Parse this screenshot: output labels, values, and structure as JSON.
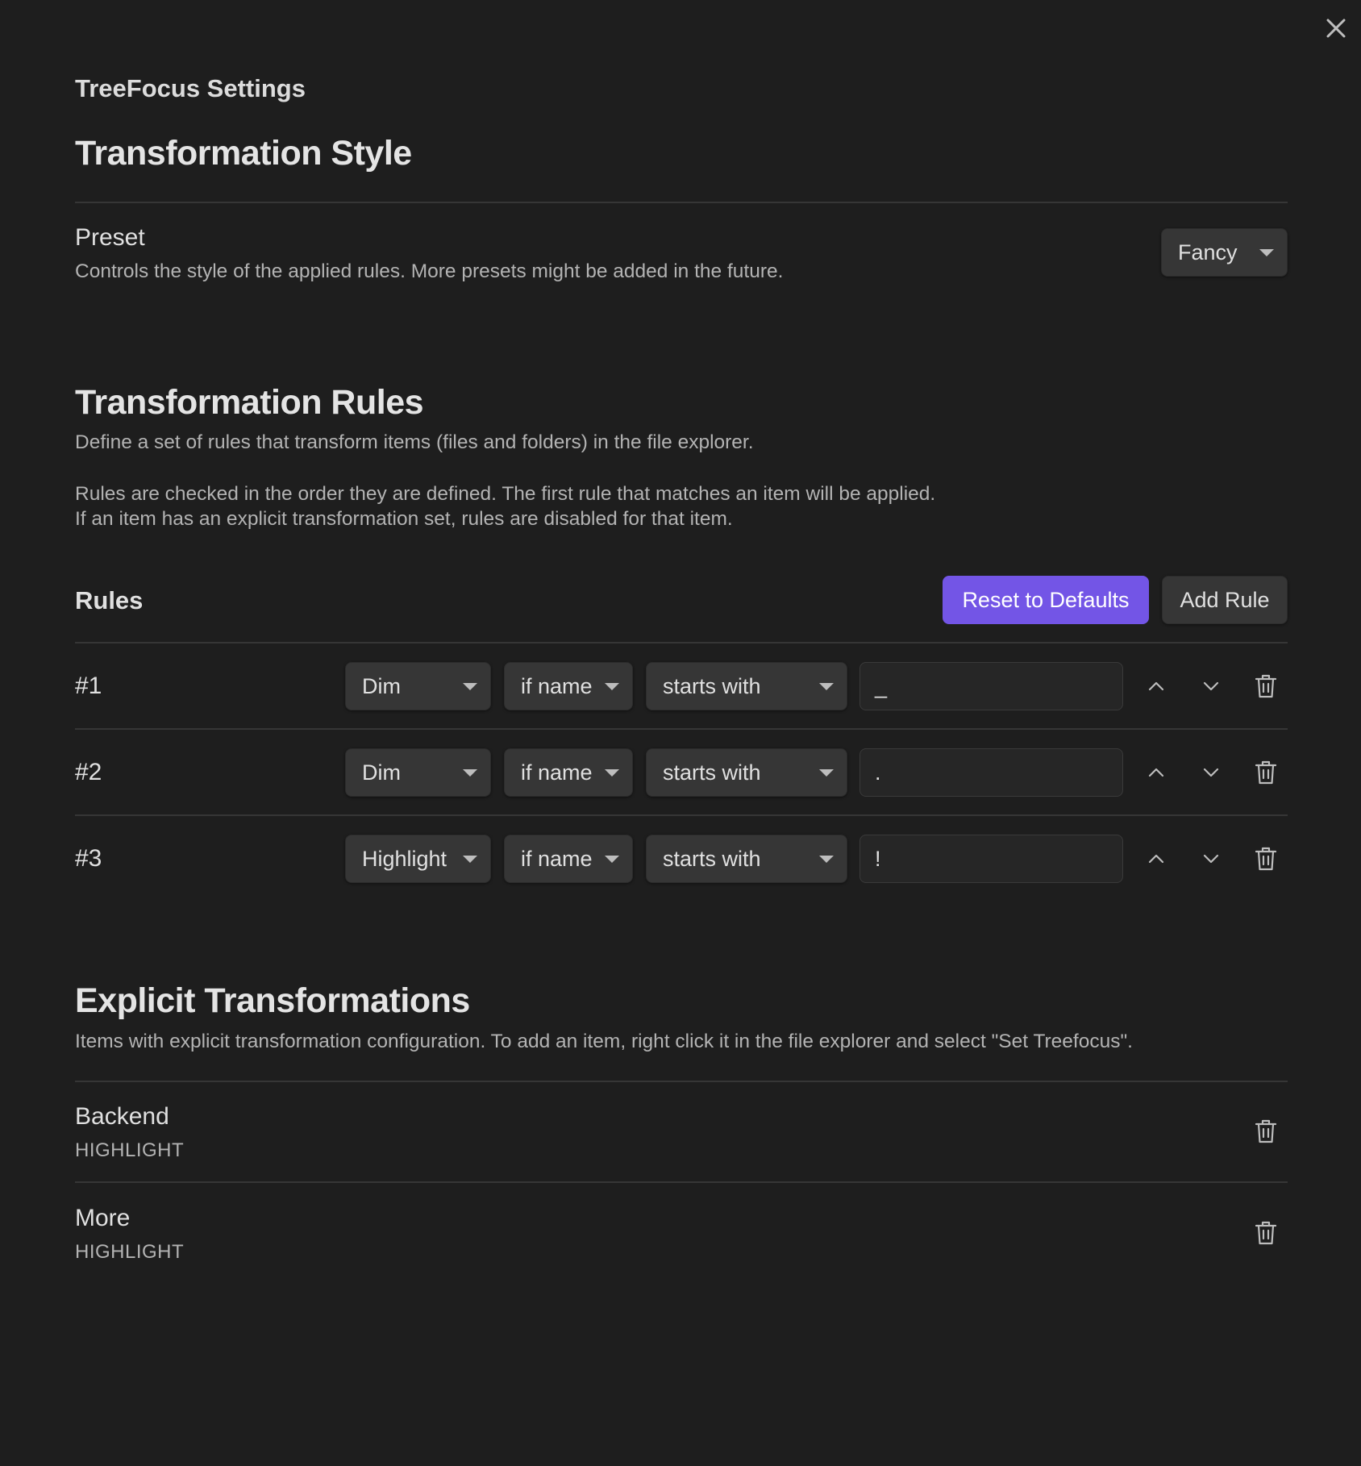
{
  "modal": {
    "plugin_title": "TreeFocus Settings",
    "close_icon": "close-icon"
  },
  "style_section": {
    "heading": "Transformation Style",
    "preset": {
      "name": "Preset",
      "description": "Controls the style of the applied rules. More presets might be added in the future.",
      "value": "Fancy"
    }
  },
  "rules_section": {
    "heading": "Transformation Rules",
    "description_1": "Define a set of rules that transform items (files and folders) in the file explorer.",
    "description_2": "Rules are checked in the order they are defined. The first rule that matches an item will be applied.\nIf an item has an explicit transformation set, rules are disabled for that item.",
    "rules_label": "Rules",
    "reset_label": "Reset to Defaults",
    "add_label": "Add Rule",
    "rules": [
      {
        "number": "#1",
        "action": "Dim",
        "field": "if name",
        "operator": "starts with",
        "value": "_"
      },
      {
        "number": "#2",
        "action": "Dim",
        "field": "if name",
        "operator": "starts with",
        "value": "."
      },
      {
        "number": "#3",
        "action": "Highlight",
        "field": "if name",
        "operator": "starts with",
        "value": "!"
      }
    ]
  },
  "explicit_section": {
    "heading": "Explicit Transformations",
    "description": "Items with explicit transformation configuration. To add an item, right click it in the file explorer and select \"Set Treefocus\".",
    "items": [
      {
        "name": "Backend",
        "type": "HIGHLIGHT"
      },
      {
        "name": "More",
        "type": "HIGHLIGHT"
      }
    ]
  },
  "colors": {
    "background": "#1e1e1e",
    "accent": "#7355e6",
    "control": "#363636"
  }
}
